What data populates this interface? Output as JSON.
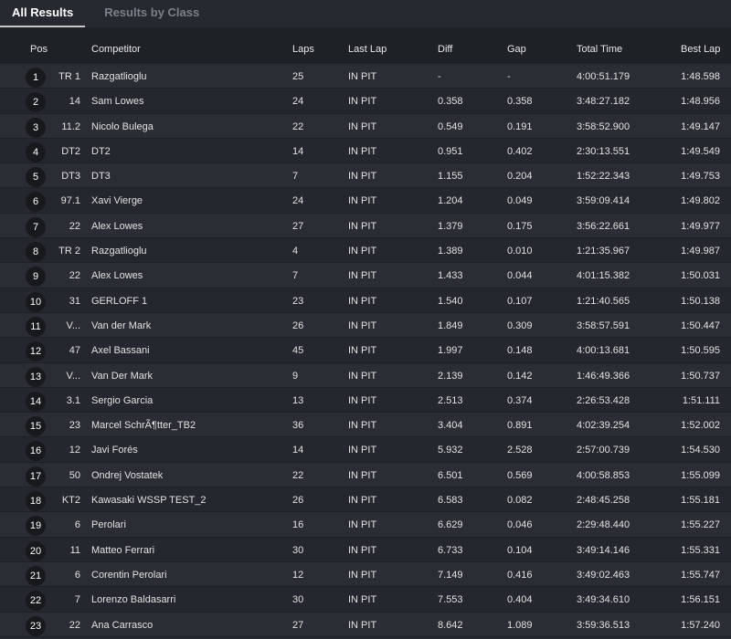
{
  "tabs": [
    {
      "label": "All Results"
    },
    {
      "label": "Results by Class"
    }
  ],
  "columns": {
    "pos": "Pos",
    "competitor": "Competitor",
    "laps": "Laps",
    "last_lap": "Last Lap",
    "diff": "Diff",
    "gap": "Gap",
    "total_time": "Total Time",
    "best_lap": "Best Lap"
  },
  "rows": [
    {
      "pos": "1",
      "num": "TR 1",
      "name": "Razgatlioglu",
      "laps": "25",
      "last": "IN PIT",
      "diff": "-",
      "gap": "-",
      "total": "4:00:51.179",
      "best": "1:48.598"
    },
    {
      "pos": "2",
      "num": "14",
      "name": "Sam Lowes",
      "laps": "24",
      "last": "IN PIT",
      "diff": "0.358",
      "gap": "0.358",
      "total": "3:48:27.182",
      "best": "1:48.956"
    },
    {
      "pos": "3",
      "num": "11.2",
      "name": "Nicolo Bulega",
      "laps": "22",
      "last": "IN PIT",
      "diff": "0.549",
      "gap": "0.191",
      "total": "3:58:52.900",
      "best": "1:49.147"
    },
    {
      "pos": "4",
      "num": "DT2",
      "name": "DT2",
      "laps": "14",
      "last": "IN PIT",
      "diff": "0.951",
      "gap": "0.402",
      "total": "2:30:13.551",
      "best": "1:49.549"
    },
    {
      "pos": "5",
      "num": "DT3",
      "name": "DT3",
      "laps": "7",
      "last": "IN PIT",
      "diff": "1.155",
      "gap": "0.204",
      "total": "1:52:22.343",
      "best": "1:49.753"
    },
    {
      "pos": "6",
      "num": "97.1",
      "name": "Xavi Vierge",
      "laps": "24",
      "last": "IN PIT",
      "diff": "1.204",
      "gap": "0.049",
      "total": "3:59:09.414",
      "best": "1:49.802"
    },
    {
      "pos": "7",
      "num": "22",
      "name": "Alex Lowes",
      "laps": "27",
      "last": "IN PIT",
      "diff": "1.379",
      "gap": "0.175",
      "total": "3:56:22.661",
      "best": "1:49.977"
    },
    {
      "pos": "8",
      "num": "TR 2",
      "name": "Razgatlioglu",
      "laps": "4",
      "last": "IN PIT",
      "diff": "1.389",
      "gap": "0.010",
      "total": "1:21:35.967",
      "best": "1:49.987"
    },
    {
      "pos": "9",
      "num": "22",
      "name": "Alex Lowes",
      "laps": "7",
      "last": "IN PIT",
      "diff": "1.433",
      "gap": "0.044",
      "total": "4:01:15.382",
      "best": "1:50.031"
    },
    {
      "pos": "10",
      "num": "31",
      "name": "GERLOFF 1",
      "laps": "23",
      "last": "IN PIT",
      "diff": "1.540",
      "gap": "0.107",
      "total": "1:21:40.565",
      "best": "1:50.138"
    },
    {
      "pos": "11",
      "num": "V...",
      "name": "Van der Mark",
      "laps": "26",
      "last": "IN PIT",
      "diff": "1.849",
      "gap": "0.309",
      "total": "3:58:57.591",
      "best": "1:50.447"
    },
    {
      "pos": "12",
      "num": "47",
      "name": "Axel Bassani",
      "laps": "45",
      "last": "IN PIT",
      "diff": "1.997",
      "gap": "0.148",
      "total": "4:00:13.681",
      "best": "1:50.595"
    },
    {
      "pos": "13",
      "num": "V...",
      "name": "Van Der Mark",
      "laps": "9",
      "last": "IN PIT",
      "diff": "2.139",
      "gap": "0.142",
      "total": "1:46:49.366",
      "best": "1:50.737"
    },
    {
      "pos": "14",
      "num": "3.1",
      "name": "Sergio Garcia",
      "laps": "13",
      "last": "IN PIT",
      "diff": "2.513",
      "gap": "0.374",
      "total": "2:26:53.428",
      "best": "1:51.111"
    },
    {
      "pos": "15",
      "num": "23",
      "name": "Marcel SchrÃ¶tter_TB2",
      "laps": "36",
      "last": "IN PIT",
      "diff": "3.404",
      "gap": "0.891",
      "total": "4:02:39.254",
      "best": "1:52.002"
    },
    {
      "pos": "16",
      "num": "12",
      "name": "Javi Forés",
      "laps": "14",
      "last": "IN PIT",
      "diff": "5.932",
      "gap": "2.528",
      "total": "2:57:00.739",
      "best": "1:54.530"
    },
    {
      "pos": "17",
      "num": "50",
      "name": "Ondrej Vostatek",
      "laps": "22",
      "last": "IN PIT",
      "diff": "6.501",
      "gap": "0.569",
      "total": "4:00:58.853",
      "best": "1:55.099"
    },
    {
      "pos": "18",
      "num": "KT2",
      "name": "Kawasaki WSSP TEST_2",
      "laps": "26",
      "last": "IN PIT",
      "diff": "6.583",
      "gap": "0.082",
      "total": "2:48:45.258",
      "best": "1:55.181"
    },
    {
      "pos": "19",
      "num": "6",
      "name": "Perolari",
      "laps": "16",
      "last": "IN PIT",
      "diff": "6.629",
      "gap": "0.046",
      "total": "2:29:48.440",
      "best": "1:55.227"
    },
    {
      "pos": "20",
      "num": "11",
      "name": "Matteo Ferrari",
      "laps": "30",
      "last": "IN PIT",
      "diff": "6.733",
      "gap": "0.104",
      "total": "3:49:14.146",
      "best": "1:55.331"
    },
    {
      "pos": "21",
      "num": "6",
      "name": "Corentin Perolari",
      "laps": "12",
      "last": "IN PIT",
      "diff": "7.149",
      "gap": "0.416",
      "total": "3:49:02.463",
      "best": "1:55.747"
    },
    {
      "pos": "22",
      "num": "7",
      "name": "Lorenzo Baldasarri",
      "laps": "30",
      "last": "IN PIT",
      "diff": "7.553",
      "gap": "0.404",
      "total": "3:49:34.610",
      "best": "1:56.151"
    },
    {
      "pos": "23",
      "num": "22",
      "name": "Ana Carrasco",
      "laps": "27",
      "last": "IN PIT",
      "diff": "8.642",
      "gap": "1.089",
      "total": "3:59:36.513",
      "best": "1:57.240"
    }
  ]
}
